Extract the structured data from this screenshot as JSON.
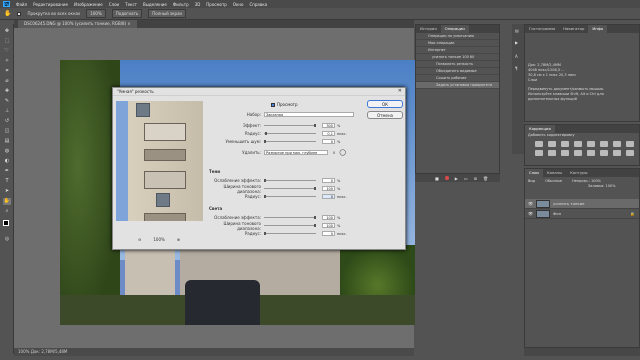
{
  "app": {
    "logo": "Ps"
  },
  "menu": [
    "Файл",
    "Редактирование",
    "Изображение",
    "Слои",
    "Текст",
    "Выделение",
    "Фильтр",
    "3D",
    "Просмотр",
    "Окно",
    "Справка"
  ],
  "options": {
    "scrub_label": "Прокрутка во всех окнах",
    "zoom": "100%",
    "fit_btn": "Подогнать",
    "fill_btn": "Полный экран"
  },
  "document": {
    "tab": "DSC06245.DNG @ 100% (усилить тонкие, RGB/8) ×",
    "status": "100%   Док: 2,78M/5,48M"
  },
  "dialog": {
    "title": "\"Умная\" резкость",
    "preview_label": "Просмотр",
    "ok": "ОК",
    "cancel": "Отмена",
    "preset_label": "Набор:",
    "preset_value": "Заказная",
    "effect_label": "Эффект:",
    "effect_value": "300",
    "radius_label": "Радиус:",
    "radius_value": "0,1",
    "noise_label": "Уменьшить шум:",
    "noise_value": "0",
    "remove_label": "Удалить:",
    "remove_value": "Размытие при мал. глубине",
    "angle_value": "0",
    "pct": "%",
    "px": "пикс.",
    "zoom_value": "100%",
    "shadows_title": "Тени",
    "highlights_title": "Света",
    "fade_label": "Ослабление эффекта:",
    "tonal_label": "Ширина тонового диапазона:",
    "r_label": "Радиус:",
    "shadows": {
      "fade": "0",
      "tonal": "100",
      "radius": "0"
    },
    "highlights": {
      "fade": "100",
      "tonal": "100",
      "radius": "0"
    }
  },
  "history": {
    "tabs": [
      "История",
      "Операции"
    ],
    "items": [
      "Операции по умолчанию",
      "Мои операции",
      "Интернет",
      "усилить тонкие 100 60 ",
      "Позволить резкость",
      "Объединить видимые",
      "Сошить рабочие",
      "Задать установки приоритета"
    ]
  },
  "right_tabs": [
    "Гистограмма",
    "Навигатор",
    "Инфо"
  ],
  "info": {
    "lines": [
      "Док: 2,78M/2,4MM",
      "4048 пикс/1208,5 ...",
      "30,8 см x 1 пикс 20,3 пикс",
      "Слои",
      "Передвинуть документ/размыть мышью.",
      "Используйте клавиши Shift, Alt и Ctrl для",
      "дополнительных функций"
    ]
  },
  "adjust": {
    "title": "Коррекция",
    "subtitle": "Добавить корректировку"
  },
  "layers": {
    "tabs": [
      "Слои",
      "Каналы",
      "Контуры"
    ],
    "kind": "Вид",
    "mode": "Обычные",
    "opacity": "Непрозр.: 100%",
    "fill": "Заливка: 100%",
    "items": [
      {
        "name": "усилить тонкие",
        "selected": true
      },
      {
        "name": "Фон",
        "selected": false
      }
    ]
  }
}
